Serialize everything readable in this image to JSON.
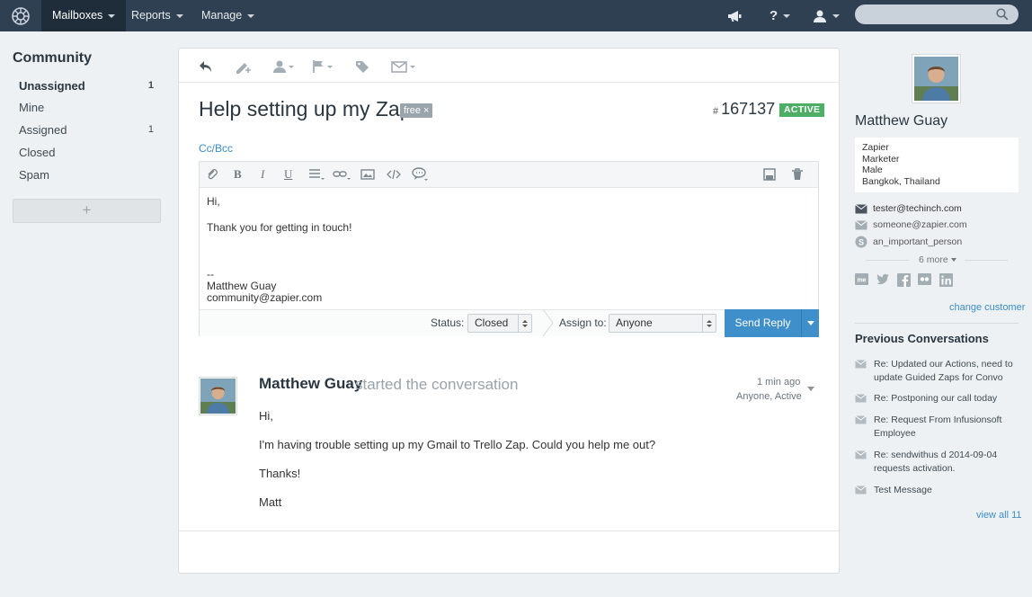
{
  "nav": {
    "items": [
      {
        "label": "Mailboxes",
        "active": true
      },
      {
        "label": "Reports",
        "active": false
      },
      {
        "label": "Manage",
        "active": false
      }
    ],
    "search_placeholder": ""
  },
  "sidebar": {
    "title": "Community",
    "folders": [
      {
        "label": "Unassigned",
        "count": "1",
        "selected": true
      },
      {
        "label": "Mine",
        "count": ""
      },
      {
        "label": "Assigned",
        "count": "1"
      },
      {
        "label": "Closed",
        "count": ""
      },
      {
        "label": "Spam",
        "count": ""
      }
    ],
    "add_label": "+"
  },
  "conversation": {
    "subject": "Help setting up my Zap",
    "tag": "free ×",
    "number_prefix": "#",
    "number": "167137",
    "status": "ACTIVE",
    "cc_bcc": "Cc/Bcc",
    "reply_lines": [
      "Hi,",
      "Thank you for getting in touch!",
      "--",
      "Matthew Guay",
      "community@zapier.com"
    ],
    "status_label": "Status:",
    "status_value": "Closed",
    "assign_label": "Assign to:",
    "assign_value": "Anyone",
    "send_label": "Send Reply",
    "thread": {
      "author": "Matthew Guay",
      "action": "started the conversation",
      "time": "1 min ago",
      "assignment": "Anyone, Active",
      "lines": [
        "Hi,",
        "I'm having trouble setting up my Gmail to Trello Zap. Could you help me out?",
        "Thanks!",
        "Matt"
      ]
    }
  },
  "customer": {
    "name": "Matthew Guay",
    "details": [
      "Zapier",
      "Marketer",
      "Male",
      "Bangkok, Thailand"
    ],
    "emails": [
      "tester@techinch.com",
      "someone@zapier.com"
    ],
    "skype": "an_important_person",
    "more": "6 more",
    "change": "change customer",
    "social_icons": [
      "mail-icon",
      "twitter-icon",
      "facebook-icon",
      "flickr-icon",
      "linkedin-icon"
    ]
  },
  "previous": {
    "title": "Previous Conversations",
    "items": [
      "Re: Updated our Actions, need to update Guided Zaps for Convo",
      "Re: Postponing our call today",
      "Re: Request From Infusionsoft Employee",
      "Re: sendwithus d 2014-09-04 requests activation.",
      "Test Message"
    ],
    "view_all": "view all 11"
  },
  "colors": {
    "nav_bg": "#2f4052",
    "accent": "#3f8fcb",
    "active_badge": "#4caf65"
  }
}
